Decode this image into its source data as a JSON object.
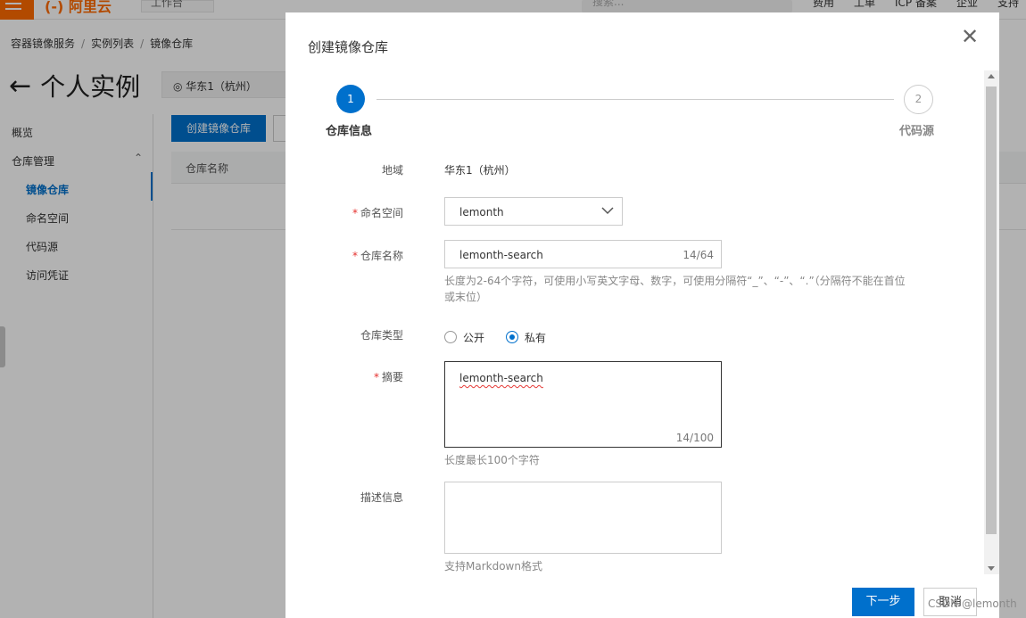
{
  "topbar": {
    "logo": "(-) 阿里云",
    "workbench": "工作台",
    "search_placeholder": "搜索...",
    "nav": [
      "费用",
      "工单",
      "ICP 备案",
      "企业",
      "支持"
    ]
  },
  "breadcrumb": [
    "容器镜像服务",
    "实例列表",
    "镜像仓库"
  ],
  "page": {
    "title": "个人实例",
    "region": "华东1（杭州）"
  },
  "sidebar": {
    "items": [
      "概览",
      "仓库管理",
      "镜像仓库",
      "命名空间",
      "代码源",
      "访问凭证"
    ]
  },
  "main": {
    "create_button": "创建镜像仓库",
    "column_header": "仓库名称"
  },
  "dialog": {
    "title": "创建镜像仓库",
    "steps": [
      {
        "number": "1",
        "label": "仓库信息"
      },
      {
        "number": "2",
        "label": "代码源"
      }
    ],
    "fields": {
      "region_label": "地域",
      "region_value": "华东1（杭州）",
      "namespace_label": "命名空间",
      "namespace_value": "lemonth",
      "name_label": "仓库名称",
      "name_value": "lemonth-search",
      "name_counter": "14/64",
      "name_hint_line1": "长度为2-64个字符，可使用小写英文字母、数字，可使用分隔符“_”、“-”、“.”（分隔符不能在首位",
      "name_hint_line2": "或末位）",
      "type_label": "仓库类型",
      "type_options": [
        "公开",
        "私有"
      ],
      "type_selected": "私有",
      "summary_label": "摘要",
      "summary_value": "lemonth-search",
      "summary_counter": "14/100",
      "summary_hint": "长度最长100个字符",
      "desc_label": "描述信息",
      "desc_hint": "支持Markdown格式"
    },
    "buttons": {
      "next": "下一步",
      "cancel": "取消"
    }
  },
  "watermark": "CSDN @lemonth",
  "colors": {
    "primary": "#0070cc",
    "brand": "#ff6a00",
    "required": "#e5302e"
  }
}
